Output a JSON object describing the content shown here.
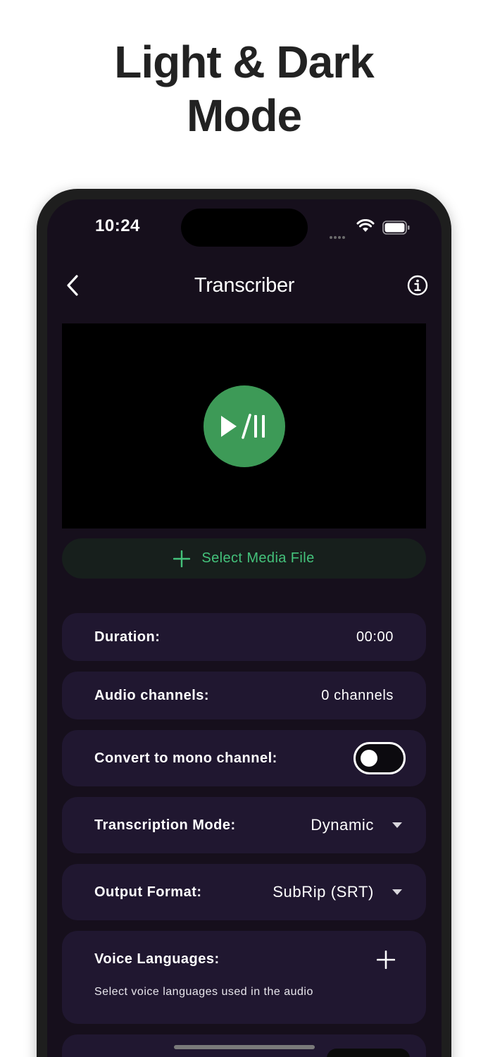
{
  "promo": {
    "title_line1": "Light & Dark",
    "title_line2": "Mode"
  },
  "status_bar": {
    "time": "10:24"
  },
  "nav": {
    "title": "Transcriber",
    "back_icon": "chevron-left-icon",
    "info_icon": "info-icon"
  },
  "player": {
    "icon": "play-pause-icon",
    "accent": "#3d9a57"
  },
  "select_media": {
    "label": "Select Media File",
    "accent": "#44c27b"
  },
  "rows": {
    "duration": {
      "label": "Duration:",
      "value": "00:00"
    },
    "audio_channels": {
      "label": "Audio channels:",
      "value": "0 channels"
    },
    "mono": {
      "label": "Convert to mono channel:",
      "toggle_on": false
    },
    "transcription_mode": {
      "label": "Transcription Mode:",
      "value": "Dynamic"
    },
    "output_format": {
      "label": "Output Format:",
      "value": "SubRip (SRT)"
    },
    "voice_languages": {
      "label": "Voice Languages:",
      "hint": "Select voice languages used in the audio"
    }
  },
  "colors": {
    "background": "#160f1c",
    "card": "#201730",
    "text": "#ffffff"
  }
}
